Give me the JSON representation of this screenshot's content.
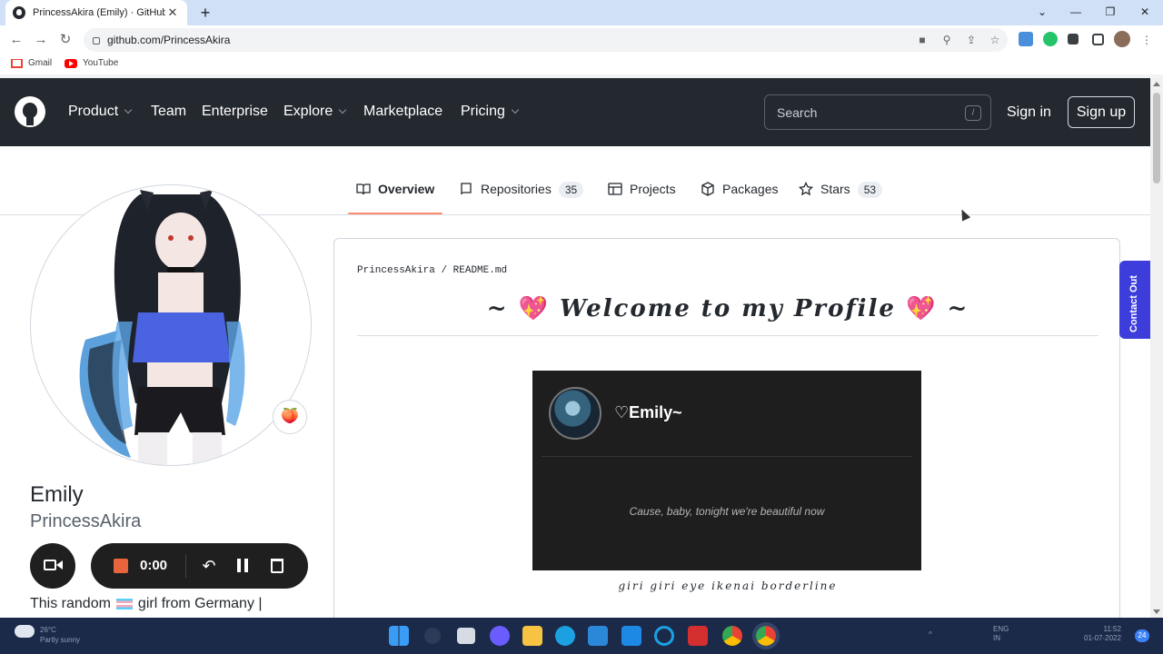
{
  "browser": {
    "tab_title": "PrincessAkira (Emily) · GitHub",
    "url": "github.com/PrincessAkira",
    "bookmarks": [
      "Gmail",
      "YouTube"
    ]
  },
  "header": {
    "nav": [
      "Product",
      "Team",
      "Enterprise",
      "Explore",
      "Marketplace",
      "Pricing"
    ],
    "search_placeholder": "Search",
    "search_shortcut": "/",
    "sign_in": "Sign in",
    "sign_up": "Sign up"
  },
  "profile_tabs": [
    {
      "label": "Overview"
    },
    {
      "label": "Repositories",
      "count": "35"
    },
    {
      "label": "Projects"
    },
    {
      "label": "Packages"
    },
    {
      "label": "Stars",
      "count": "53"
    }
  ],
  "profile": {
    "name": "Emily",
    "username": "PrincessAkira",
    "status_emoji": "🍑",
    "bio_start": "This random",
    "bio_end": "girl from Germany |"
  },
  "recorder": {
    "time": "0:00"
  },
  "readme": {
    "path_user": "PrincessAkira",
    "path_sep": "/",
    "path_file": "README.md",
    "title": "Welcome to my Profile",
    "title_prefix": "~",
    "title_suffix": "~",
    "heart": "💖",
    "card_name": "♡Emily~",
    "card_quote": "Cause, baby, tonight we're beautiful now",
    "caption": "giri giri eye ikenai borderline"
  },
  "contact_button": "Contact Out",
  "taskbar": {
    "weather_temp": "26°C",
    "weather_desc": "Partly sunny",
    "lang": "ENG",
    "region": "IN",
    "time": "11:52",
    "date": "01-07-2022",
    "notifications": "24"
  },
  "colors": {
    "header_bg": "#24292f",
    "active_tab_underline": "#fd8c73",
    "contact_bg": "#3d3ddc",
    "recorder_stop": "#e8643a"
  }
}
